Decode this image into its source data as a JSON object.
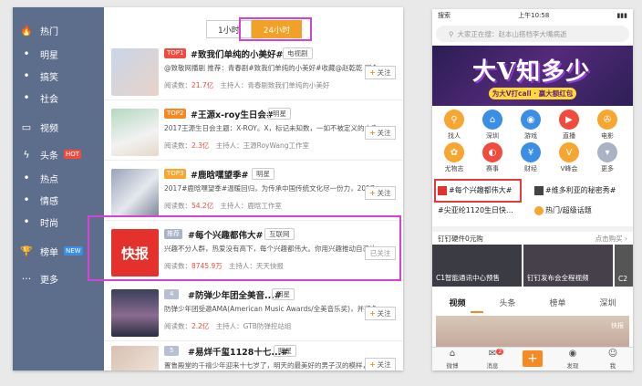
{
  "left": {
    "sidebar": [
      {
        "icon": "flame-icon",
        "glyph": "🔥",
        "label": "热门",
        "badge": ""
      },
      {
        "icon": "",
        "glyph": "•",
        "label": "明星",
        "badge": ""
      },
      {
        "icon": "",
        "glyph": "•",
        "label": "搞笑",
        "badge": ""
      },
      {
        "icon": "",
        "glyph": "•",
        "label": "社会",
        "badge": ""
      },
      {
        "icon": "video-icon",
        "glyph": "▭",
        "label": "视频",
        "badge": ""
      },
      {
        "icon": "bolt-icon",
        "glyph": "ϟ",
        "label": "头条",
        "badge": "HOT"
      },
      {
        "icon": "",
        "glyph": "•",
        "label": "热点",
        "badge": ""
      },
      {
        "icon": "",
        "glyph": "•",
        "label": "情感",
        "badge": ""
      },
      {
        "icon": "",
        "glyph": "•",
        "label": "时尚",
        "badge": ""
      },
      {
        "icon": "trophy-icon",
        "glyph": "🏆",
        "label": "榜单",
        "badge": "NEW"
      },
      {
        "icon": "more-icon",
        "glyph": "···",
        "label": "更多",
        "badge": ""
      }
    ],
    "tabs": [
      "1小时",
      "24小时"
    ],
    "rows": [
      {
        "rank": "TOP1",
        "title": "#致我们单纯的小美好#",
        "tag": "电视剧",
        "desc": "@致敬网播剧 推荐：青春剧#致我们单纯的小美好#收藏@赵乾乾 同名...",
        "reads_label": "阅读数：",
        "reads": "21.7亿",
        "host": "主持人：青春剧致我们单纯的小美好",
        "follow": "关注"
      },
      {
        "rank": "TOP2",
        "title": "#王源x-roy生日会#",
        "tag": "明星",
        "desc": "2017王源生日会主题：X-ROY。X，标记未知数，一如不被定义的未来。X",
        "reads_label": "阅读数：",
        "reads": "2.3亿",
        "host": "主持人：王源RoyWang工作室",
        "follow": "关注"
      },
      {
        "rank": "TOP3",
        "title": "#鹿晗嘿望季#",
        "tag": "明星",
        "desc": "2017#鹿晗嘿望季#温暖回归，为传承中国传统文化尽一份力，2017年",
        "reads_label": "阅读数：",
        "reads": "54.2亿",
        "host": "主持人：鹿晗工作室",
        "follow": "关注"
      },
      {
        "rank": "推荐",
        "title": "#每个兴趣都伟大#",
        "tag": "互联网",
        "desc": "兴趣不分人群，热爱没有高下，每个兴趣都伟大。你用兴趣推动自己的世...",
        "reads_label": "阅读数：",
        "reads": "8745.9万",
        "host": "主持人：天天快报",
        "follow": "已关注"
      },
      {
        "rank": "4",
        "title": "#防弹少年团全美音...#",
        "tag": "明星",
        "desc": "防弹少年团受邀AMA(American Music Awards/全美音乐奖)，并将名艺...",
        "reads_label": "阅读数：",
        "reads": "2.2亿",
        "host": "主持人：GTB防弹控站组",
        "follow": "关注"
      },
      {
        "rank": "5",
        "title": "#易烊千玺1128十七...#",
        "tag": "明星",
        "desc": "置鲁殿堂的千禧少年迎来十七岁了，明天的最美好的男子汉的模样，想把世界最美最",
        "reads_label": "",
        "reads": "",
        "host": "",
        "follow": "关注"
      }
    ],
    "kb_logo": "快报"
  },
  "phone": {
    "status_left": "搜索",
    "status_time": "上午10:58",
    "status_right": "▮▮▮",
    "search_placeholder": "大家正在搜：赵本山搭档李大嘴病逝",
    "banner_title": "大V知多少",
    "banner_sub": "为大V打call · 赢大额红包",
    "grid": [
      {
        "label": "找人",
        "color": "#f7a631",
        "glyph": "⚲"
      },
      {
        "label": "深圳",
        "color": "#3a8ee6",
        "glyph": "⌂"
      },
      {
        "label": "游戏",
        "color": "#3a8ee6",
        "glyph": "◉"
      },
      {
        "label": "直播",
        "color": "#f04b3c",
        "glyph": "▶"
      },
      {
        "label": "电影",
        "color": "#f7a631",
        "glyph": "✇"
      },
      {
        "label": "尤物志",
        "color": "#f7a631",
        "glyph": "✿"
      },
      {
        "label": "赛事",
        "color": "#f04b3c",
        "glyph": "◐"
      },
      {
        "label": "财经",
        "color": "#3a8ee6",
        "glyph": "¥"
      },
      {
        "label": "V峰会",
        "color": "#f7a631",
        "glyph": "V"
      },
      {
        "label": "更多",
        "color": "#aab2c6",
        "glyph": "▾"
      }
    ],
    "trends": [
      "#每个兴趣都伟大#",
      "#维多利亚的秘密秀#",
      "#尖亚纶1120生日快...",
      "热门/超级话题"
    ],
    "ding_title": "钉钉硬件0元购",
    "ding_more": "点击购买 ›",
    "videos": [
      "C1智能通讯中心预售",
      "钉钉发布会全程视频",
      "C2"
    ],
    "subtabs": [
      "视频",
      "头条",
      "榜单",
      "深圳"
    ],
    "video2_mark": "快报",
    "bottom": [
      {
        "icon": "home-icon",
        "glyph": "⌂",
        "label": "微博"
      },
      {
        "icon": "mail-icon",
        "glyph": "✉",
        "label": "消息",
        "badge": "2"
      },
      {
        "icon": "add-icon",
        "glyph": "+",
        "label": ""
      },
      {
        "icon": "discover-icon",
        "glyph": "◉",
        "label": "发现"
      },
      {
        "icon": "profile-icon",
        "glyph": "☺",
        "label": "我"
      }
    ]
  }
}
